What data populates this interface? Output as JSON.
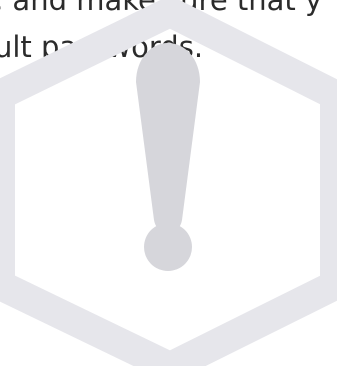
{
  "content": {
    "text_line_1": ", and make sure that y",
    "text_line_2": "ult passwords."
  },
  "graphic": {
    "icon_name": "warning-hexagon-icon",
    "hexagon_color": "#e6e6eb",
    "exclamation_color": "#d6d6db"
  }
}
